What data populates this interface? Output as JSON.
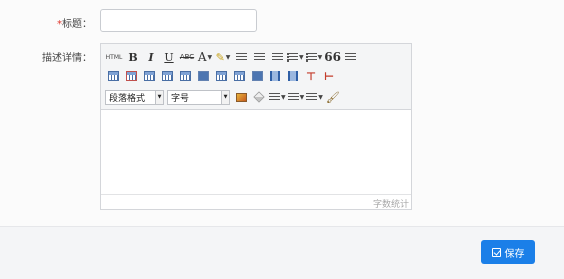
{
  "form": {
    "title_label_required": "*",
    "title_label": "标题：",
    "title_value": "",
    "desc_label": "描述详情："
  },
  "editor": {
    "toolbar": {
      "html": "HTML",
      "bold": "B",
      "italic": "I",
      "underline": "U",
      "strikethrough": "ABC",
      "font_color": "A",
      "quote": "66",
      "paragraph_select": "段落格式",
      "font_size_select": "字号"
    },
    "word_count_label": "字数统计",
    "content": ""
  },
  "footer": {
    "save_label": "保存"
  },
  "colors": {
    "primary": "#1b7fe8",
    "required": "#e0352b"
  }
}
